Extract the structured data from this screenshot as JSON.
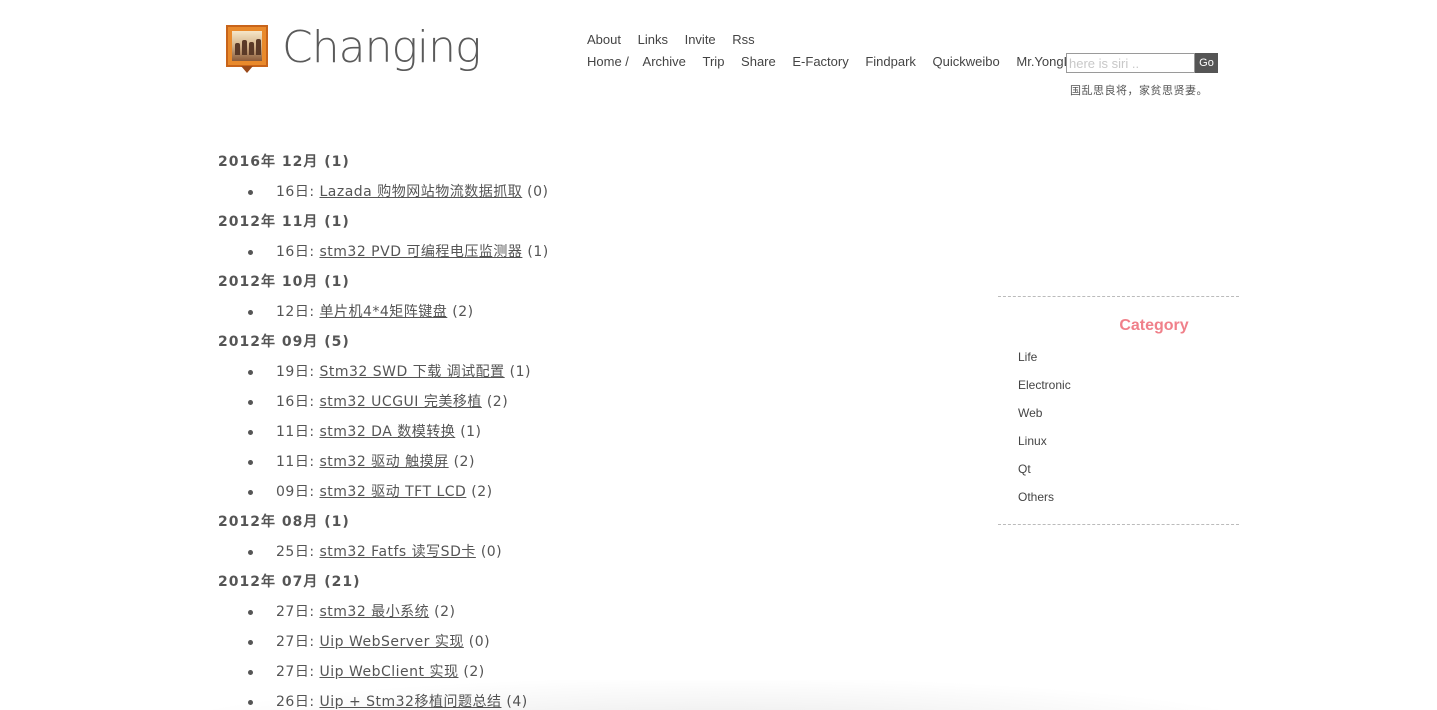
{
  "header": {
    "site_title": "Changing",
    "logo_icon": "photo-logo-icon",
    "nav_top": [
      "About",
      "Links",
      "Invite",
      "Rss"
    ],
    "nav_main": [
      "Home /",
      "Archive",
      "Trip",
      "Share",
      "E-Factory",
      "Findpark",
      "Quickweibo",
      "Mr.YongLan"
    ],
    "search": {
      "placeholder": "here is siri ..",
      "button_label": "Go"
    },
    "motto": "国乱思良将，家贫思贤妻。"
  },
  "archive": [
    {
      "month": "2016年 12月 (1)",
      "posts": [
        {
          "day": "16日:",
          "title": "Lazada 购物网站物流数据抓取",
          "count": "(0)"
        }
      ]
    },
    {
      "month": "2012年 11月 (1)",
      "posts": [
        {
          "day": "16日:",
          "title": "stm32 PVD 可编程电压监测器",
          "count": "(1)"
        }
      ]
    },
    {
      "month": "2012年 10月 (1)",
      "posts": [
        {
          "day": "12日:",
          "title": "单片机4*4矩阵键盘",
          "count": "(2)"
        }
      ]
    },
    {
      "month": "2012年 09月 (5)",
      "posts": [
        {
          "day": "19日:",
          "title": "Stm32 SWD 下载 调试配置",
          "count": "(1)"
        },
        {
          "day": "16日:",
          "title": "stm32 UCGUI 完美移植",
          "count": "(2)"
        },
        {
          "day": "11日:",
          "title": "stm32 DA 数模转换",
          "count": "(1)"
        },
        {
          "day": "11日:",
          "title": "stm32 驱动 触摸屏",
          "count": "(2)"
        },
        {
          "day": "09日:",
          "title": "stm32 驱动 TFT LCD",
          "count": "(2)"
        }
      ]
    },
    {
      "month": "2012年 08月 (1)",
      "posts": [
        {
          "day": "25日:",
          "title": "stm32 Fatfs 读写SD卡",
          "count": "(0)"
        }
      ]
    },
    {
      "month": "2012年 07月 (21)",
      "posts": [
        {
          "day": "27日:",
          "title": "stm32 最小系统",
          "count": "(2)"
        },
        {
          "day": "27日:",
          "title": "Uip WebServer 实现",
          "count": "(0)"
        },
        {
          "day": "27日:",
          "title": "Uip WebClient 实现",
          "count": "(2)"
        },
        {
          "day": "26日:",
          "title": "Uip + Stm32移植问题总结",
          "count": "(4)"
        }
      ]
    }
  ],
  "sidebar": {
    "category_title": "Category",
    "categories": [
      "Life",
      "Electronic",
      "Web",
      "Linux",
      "Qt",
      "Others"
    ],
    "colors": {
      "category_title": "#f0808a"
    }
  }
}
